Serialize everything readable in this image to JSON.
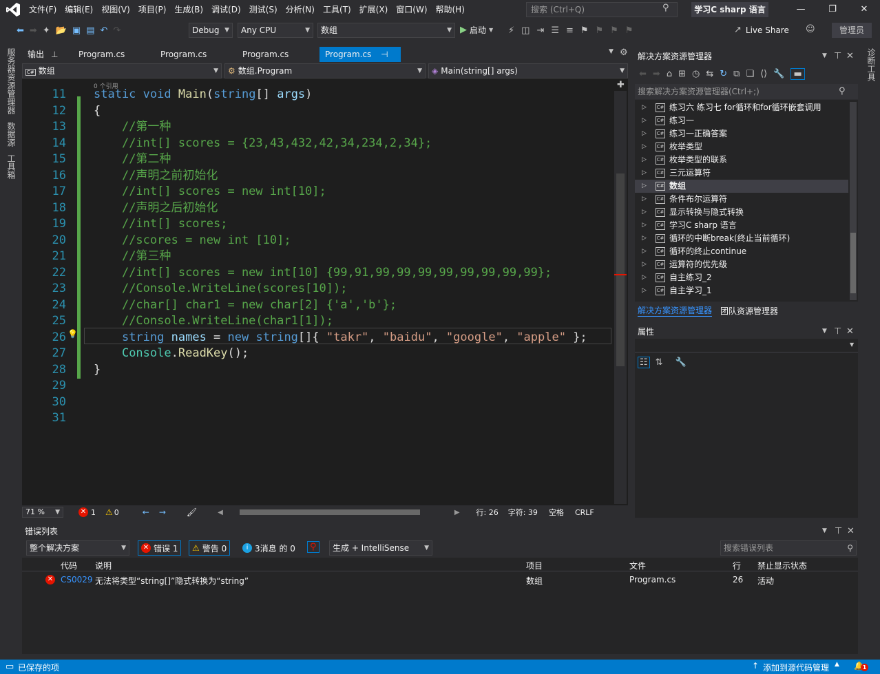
{
  "menu": [
    "文件(F)",
    "编辑(E)",
    "视图(V)",
    "项目(P)",
    "生成(B)",
    "调试(D)",
    "测试(S)",
    "分析(N)",
    "工具(T)",
    "扩展(X)",
    "窗口(W)",
    "帮助(H)"
  ],
  "search": {
    "placeholder": "搜索 (Ctrl+Q)"
  },
  "solution_name": "学习C sharp 语言",
  "toolbar": {
    "config": "Debug",
    "platform": "Any CPU",
    "project": "数组",
    "start": "启动",
    "live_share": "Live Share",
    "admin": "管理员"
  },
  "side_rail": [
    "服务器资源管理器",
    "数据源",
    "工具箱"
  ],
  "right_rail": "诊断工具",
  "tabs": {
    "output": "输出",
    "t1": "Program.cs",
    "t2": "Program.cs",
    "t3": "Program.cs",
    "active": "Program.cs"
  },
  "navbar": {
    "project": "数组",
    "class": "数组.Program",
    "member": "Main(string[] args)"
  },
  "codelens": "0 个引用",
  "lines": [
    {
      "n": "11",
      "code": "static void Main(string[] args)"
    },
    {
      "n": "12",
      "code": "{"
    },
    {
      "n": "13",
      "code": "    //第一种"
    },
    {
      "n": "14",
      "code": "    //int[] scores = {23,43,432,42,34,234,2,34};"
    },
    {
      "n": "15",
      "code": "    //第二种"
    },
    {
      "n": "16",
      "code": "    //声明之前初始化"
    },
    {
      "n": "17",
      "code": "    //int[] scores = new int[10];"
    },
    {
      "n": "18",
      "code": "    //声明之后初始化"
    },
    {
      "n": "19",
      "code": "    //int[] scores;"
    },
    {
      "n": "20",
      "code": "    //scores = new int [10];"
    },
    {
      "n": "21",
      "code": "    //第三种"
    },
    {
      "n": "22",
      "code": "    //int[] scores = new int[10] {99,91,99,99,99,99,99,99,99,99};"
    },
    {
      "n": "23",
      "code": "    //Console.WriteLine(scores[10]);"
    },
    {
      "n": "24",
      "code": "    //char[] char1 = new char[2] {'a','b'};"
    },
    {
      "n": "25",
      "code": "    //Console.WriteLine(char1[1]);"
    },
    {
      "n": "26",
      "code": "    string names = new string[]{ \"takr\", \"baidu\", \"google\", \"apple\" };"
    },
    {
      "n": "27",
      "code": "    Console.ReadKey();"
    },
    {
      "n": "28",
      "code": "}"
    },
    {
      "n": "29",
      "code": ""
    },
    {
      "n": "30",
      "code": ""
    },
    {
      "n": "31",
      "code": ""
    }
  ],
  "editor_status": {
    "zoom": "71 %",
    "errors": "1",
    "warnings": "0",
    "line": "行: 26",
    "col": "字符: 39",
    "ws": "空格",
    "eol": "CRLF"
  },
  "solution_explorer": {
    "title": "解决方案资源管理器",
    "search": "搜索解决方案资源管理器(Ctrl+;)",
    "items": [
      "练习六 练习七 for循环和for循环嵌套调用",
      "练习一",
      "练习一正确答案",
      "枚举类型",
      "枚举类型的联系",
      "三元运算符",
      "数组",
      "条件布尔运算符",
      "显示转换与隐式转换",
      "学习C sharp 语言",
      "循环的中断break(终止当前循环)",
      "循环的终止continue",
      "运算符的优先级",
      "自主练习_2",
      "自主学习_1"
    ],
    "selected": "数组",
    "tab1": "解决方案资源管理器",
    "tab2": "团队资源管理器"
  },
  "properties": {
    "title": "属性"
  },
  "error_list": {
    "title": "错误列表",
    "scope": "整个解决方案",
    "errors_btn": "错误 1",
    "warnings_btn": "警告 0",
    "messages_btn": "3消息 的 0",
    "build": "生成 + IntelliSense",
    "search": "搜索错误列表",
    "columns": {
      "code": "代码",
      "desc": "说明",
      "project": "项目",
      "file": "文件",
      "line": "行",
      "suppress": "禁止显示状态"
    },
    "rows": [
      {
        "code": "CS0029",
        "desc": "无法将类型“string[]”隐式转换为“string”",
        "project": "数组",
        "file": "Program.cs",
        "line": "26",
        "suppress": "活动"
      }
    ]
  },
  "statusbar": {
    "left": "已保存的项",
    "right": "添加到源代码管理",
    "badge": "1"
  },
  "colors": {
    "accent": "#007acc",
    "error": "#e51400",
    "warning": "#ffcc00"
  }
}
